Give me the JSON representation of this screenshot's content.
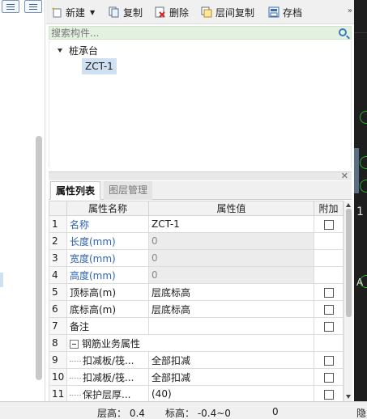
{
  "toolbar": {
    "new_label": "新建",
    "copy_label": "复制",
    "delete_label": "删除",
    "floor_copy_label": "层间复制",
    "archive_label": "存档",
    "more_label": "»"
  },
  "search": {
    "placeholder": "搜索构件..."
  },
  "tree": {
    "root_label": "桩承台",
    "selected_child": "ZCT-1"
  },
  "tabs": {
    "active": "属性列表",
    "inactive": "图层管理"
  },
  "table": {
    "columns": [
      "属性名称",
      "属性值",
      "附加"
    ],
    "rows": [
      {
        "idx": "1",
        "name": "名称",
        "value": "ZCT-1"
      },
      {
        "idx": "2",
        "name": "长度(mm)",
        "value": "0"
      },
      {
        "idx": "3",
        "name": "宽度(mm)",
        "value": "0"
      },
      {
        "idx": "4",
        "name": "高度(mm)",
        "value": "0"
      },
      {
        "idx": "5",
        "name": "顶标高(m)",
        "value": "层底标高"
      },
      {
        "idx": "6",
        "name": "底标高(m)",
        "value": "层底标高"
      },
      {
        "idx": "7",
        "name": "备注",
        "value": ""
      },
      {
        "idx": "8",
        "name": "钢筋业务属性",
        "value": ""
      },
      {
        "idx": "9",
        "name": "扣减板/筏...",
        "value": "全部扣减"
      },
      {
        "idx": "10",
        "name": "扣减板/筏...",
        "value": "全部扣减"
      },
      {
        "idx": "11",
        "name": "保护层厚...",
        "value": "(40)"
      }
    ]
  },
  "status": {
    "floor_height": "层高：  0.4",
    "elevation": "标高：  -0.4~0",
    "value": "0",
    "right_text": "隐"
  },
  "right_edge_text": {
    "digit": "1",
    "letter": "A"
  },
  "colors": {
    "accent_blue": "#2e63b5",
    "search_bg": "#e3f1e0",
    "selection_bg": "#cfe0f3",
    "dark_canvas": "#1e1e1e",
    "axis_green": "#28b428"
  }
}
